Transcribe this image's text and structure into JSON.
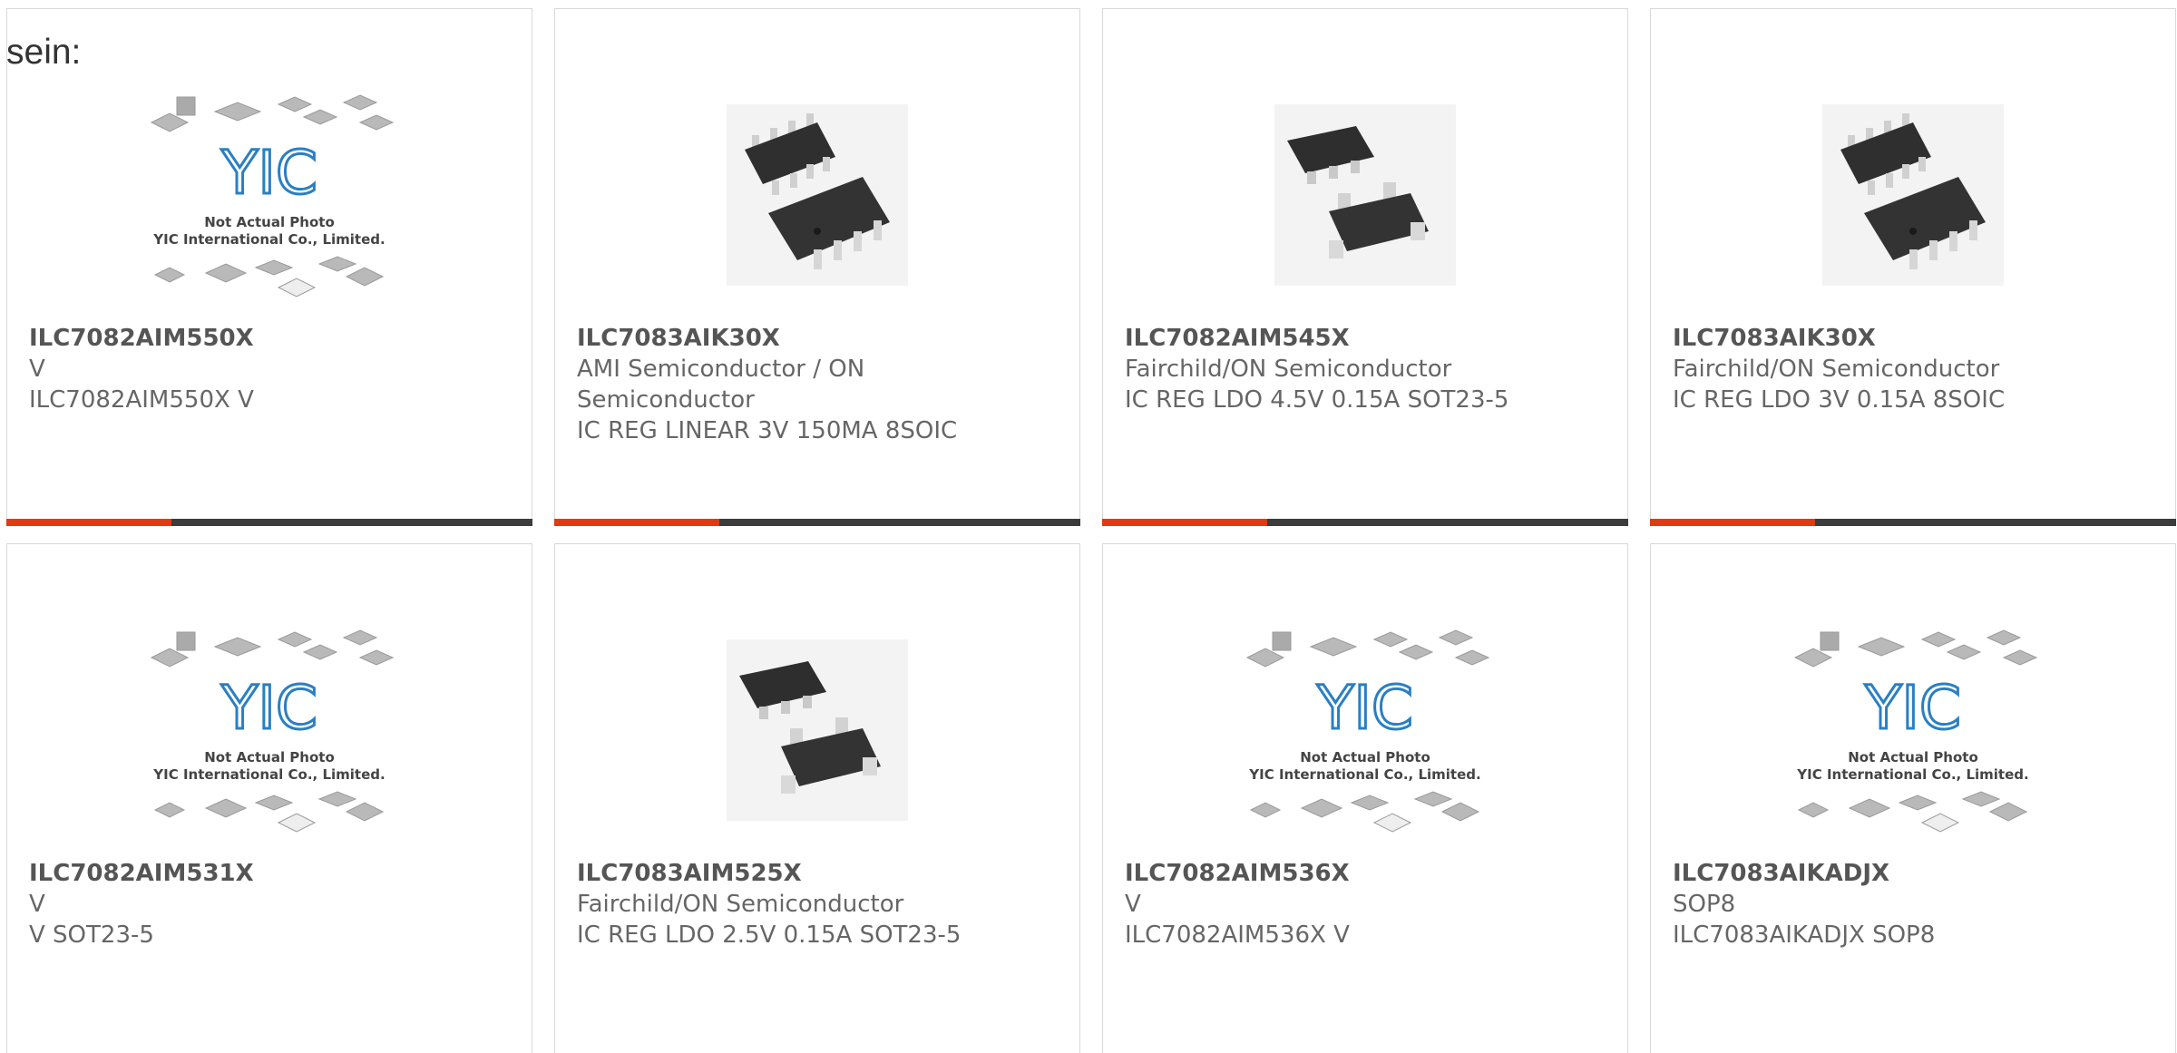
{
  "intro_text": "sein:",
  "placeholder": {
    "line1": "Not Actual Photo",
    "line2": "YIC International Co., Limited.",
    "logo": "YIC"
  },
  "accent_color": "#e03a12",
  "bar_color": "#3c3c3c",
  "products": [
    {
      "name": "ILC7082AIM550X",
      "maker": "V",
      "desc": "ILC7082AIM550X V",
      "image": "placeholder"
    },
    {
      "name": "ILC7083AIK30X",
      "maker": "AMI Semiconductor / ON Semiconductor",
      "desc": "IC REG LINEAR 3V 150MA 8SOIC",
      "image": "soic8-chip"
    },
    {
      "name": "ILC7082AIM545X",
      "maker": "Fairchild/ON Semiconductor",
      "desc": "IC REG LDO 4.5V 0.15A SOT23-5",
      "image": "sot23-chip"
    },
    {
      "name": "ILC7083AIK30X",
      "maker": "Fairchild/ON Semiconductor",
      "desc": "IC REG LDO 3V 0.15A 8SOIC",
      "image": "soic8-chip"
    },
    {
      "name": "ILC7082AIM531X",
      "maker": "V",
      "desc": "V SOT23-5",
      "image": "placeholder"
    },
    {
      "name": "ILC7083AIM525X",
      "maker": "Fairchild/ON Semiconductor",
      "desc": "IC REG LDO 2.5V 0.15A SOT23-5",
      "image": "sot23-chip"
    },
    {
      "name": "ILC7082AIM536X",
      "maker": "V",
      "desc": "ILC7082AIM536X V",
      "image": "placeholder"
    },
    {
      "name": "ILC7083AIKADJX",
      "maker": "SOP8",
      "desc": "ILC7083AIKADJX SOP8",
      "image": "placeholder"
    }
  ]
}
